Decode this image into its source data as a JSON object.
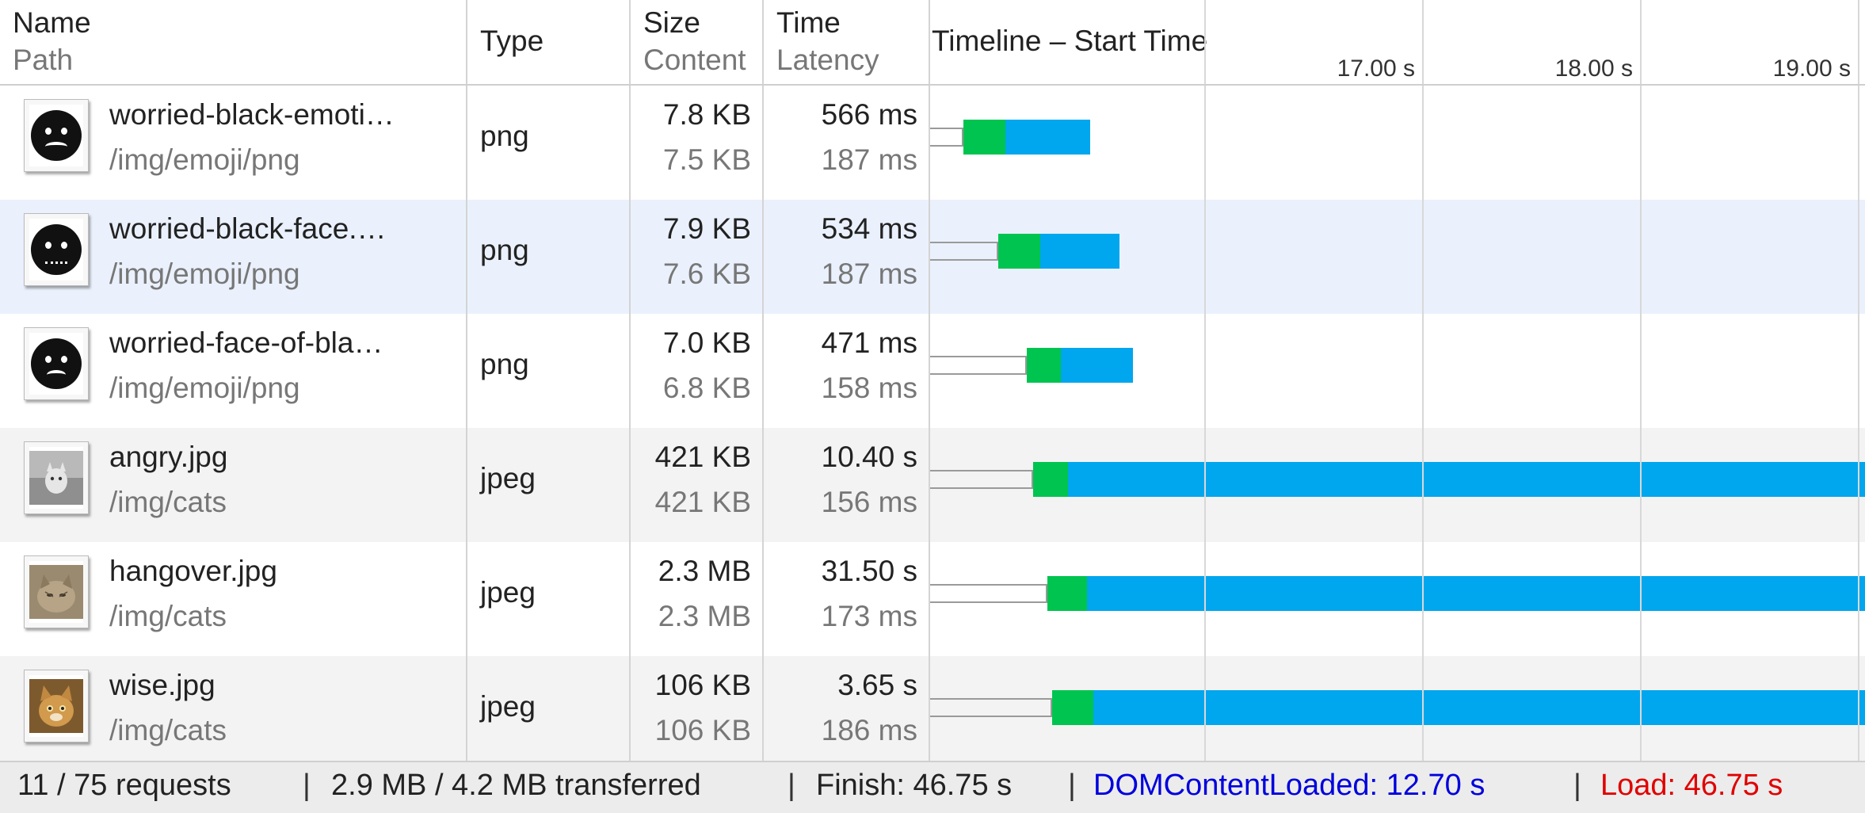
{
  "columns": {
    "name": "Name",
    "path": "Path",
    "type": "Type",
    "size": "Size",
    "content": "Content",
    "time": "Time",
    "latency": "Latency",
    "timeline": "Timeline – Start Time"
  },
  "ticks": [
    "17.00 s",
    "18.00 s",
    "19.00 s"
  ],
  "colors": {
    "row_alt": "#f3f3f3",
    "row_selected": "#eaf1fc",
    "green": "#00c450",
    "blue": "#00a6ee",
    "dom_loaded": "#0000dd",
    "load": "#e00000"
  },
  "requests": [
    {
      "name": "worried-black-emoti…",
      "path": "/img/emoji/png",
      "type": "png",
      "size": "7.8 KB",
      "content": "7.5 KB",
      "time": "566 ms",
      "latency": "187 ms",
      "thumb": "worried-emoji-icon",
      "bg": "#ffffff"
    },
    {
      "name": "worried-black-face.…",
      "path": "/img/emoji/png",
      "type": "png",
      "size": "7.9 KB",
      "content": "7.6 KB",
      "time": "534 ms",
      "latency": "187 ms",
      "thumb": "worried-emoji-icon",
      "bg": "#eaf1fc"
    },
    {
      "name": "worried-face-of-bla…",
      "path": "/img/emoji/png",
      "type": "png",
      "size": "7.0 KB",
      "content": "6.8 KB",
      "time": "471 ms",
      "latency": "158 ms",
      "thumb": "worried-emoji-icon",
      "bg": "#ffffff"
    },
    {
      "name": "angry.jpg",
      "path": "/img/cats",
      "type": "jpeg",
      "size": "421 KB",
      "content": "421 KB",
      "time": "10.40 s",
      "latency": "156 ms",
      "thumb": "cat-photo-icon",
      "bg": "#f3f3f3"
    },
    {
      "name": "hangover.jpg",
      "path": "/img/cats",
      "type": "jpeg",
      "size": "2.3 MB",
      "content": "2.3 MB",
      "time": "31.50 s",
      "latency": "173 ms",
      "thumb": "cat-photo-icon",
      "bg": "#ffffff"
    },
    {
      "name": "wise.jpg",
      "path": "/img/cats",
      "type": "jpeg",
      "size": "106 KB",
      "content": "106 KB",
      "time": "3.65 s",
      "latency": "186 ms",
      "thumb": "cat-photo-icon",
      "bg": "#f3f3f3"
    }
  ],
  "footer": {
    "requests": "11 / 75 requests",
    "transferred": "2.9 MB / 4.2 MB transferred",
    "finish": "Finish: 46.75 s",
    "dom_loaded": "DOMContentLoaded: 12.70 s",
    "load": "Load: 46.75 s",
    "separator": "|"
  }
}
